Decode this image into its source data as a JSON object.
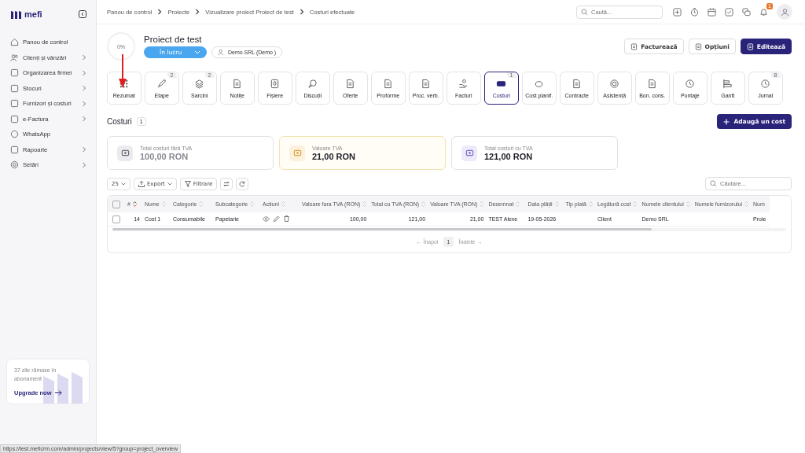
{
  "sidebar": {
    "logo": "mefi",
    "items": [
      {
        "label": "Panou de control",
        "expandable": false
      },
      {
        "label": "Clienți și vânzări",
        "expandable": true
      },
      {
        "label": "Organizarea firmei",
        "expandable": true
      },
      {
        "label": "Stocuri",
        "expandable": true
      },
      {
        "label": "Furnizori și costuri",
        "expandable": true
      },
      {
        "label": "e-Factura",
        "expandable": true
      },
      {
        "label": "WhatsApp",
        "expandable": false
      },
      {
        "label": "Rapoarte",
        "expandable": true
      },
      {
        "label": "Setări",
        "expandable": true
      }
    ],
    "upgrade": {
      "text": "37 zile rămase în abonament",
      "link": "Upgrade now"
    }
  },
  "breadcrumbs": [
    "Panou de control",
    "Proiecte",
    "Vizualizare proiect Proiect de test",
    "Costuri efectuate"
  ],
  "search": {
    "placeholder": "Caută..."
  },
  "notifications": {
    "badge": "1"
  },
  "project": {
    "progress": "0%",
    "title": "Proiect de test",
    "status": "În lucru",
    "client": "Demo SRL (Demo )"
  },
  "actions": [
    {
      "label": "Facturează",
      "primary": false
    },
    {
      "label": "Opțiuni",
      "primary": false
    },
    {
      "label": "Editează",
      "primary": true
    }
  ],
  "modules": [
    {
      "label": "Rezumat",
      "selected": false
    },
    {
      "label": "Etape",
      "badge": "2",
      "selected": false
    },
    {
      "label": "Sarcini",
      "badge": "2",
      "selected": false
    },
    {
      "label": "Notițe",
      "selected": false
    },
    {
      "label": "Fișiere",
      "selected": false
    },
    {
      "label": "Discuții",
      "selected": false
    },
    {
      "label": "Oferte",
      "selected": false
    },
    {
      "label": "Proforme",
      "selected": false
    },
    {
      "label": "Proc. verb.",
      "selected": false
    },
    {
      "label": "Facturi",
      "selected": false
    },
    {
      "label": "Costuri",
      "badge": "1",
      "selected": true
    },
    {
      "label": "Cost planif.",
      "selected": false
    },
    {
      "label": "Contracte",
      "selected": false
    },
    {
      "label": "Asistență",
      "selected": false
    },
    {
      "label": "Bon. cons.",
      "selected": false
    },
    {
      "label": "Pontaje",
      "selected": false
    },
    {
      "label": "Gantt",
      "selected": false
    },
    {
      "label": "Jurnal",
      "badge": "8",
      "selected": false
    }
  ],
  "section": {
    "title": "Costuri",
    "count": "1",
    "add_button": "Adaugă un cost"
  },
  "stats": [
    {
      "label": "Total costuri fără TVA",
      "value": "100,00 RON",
      "color": "#6b6b78",
      "highlighted": false,
      "muted": true
    },
    {
      "label": "Valoare TVA",
      "value": "21,00 RON",
      "color": "#e0a23a",
      "highlighted": true,
      "muted": false
    },
    {
      "label": "Total costuri cu TVA",
      "value": "121,00 RON",
      "color": "#7a6bd0",
      "highlighted": false,
      "muted": false
    }
  ],
  "toolbar": {
    "page_size": "25",
    "export": "Export",
    "filter": "Filtrare",
    "search_placeholder": "Căutare..."
  },
  "table": {
    "all_checked": false,
    "columns": [
      {
        "label": "#",
        "sorted": true
      },
      {
        "label": "Nume",
        "sorted": false
      },
      {
        "label": "Categorie",
        "sorted": false
      },
      {
        "label": "Subcategorie",
        "sorted": false
      },
      {
        "label": "Acțiuni",
        "sorted": false,
        "kind": "actions"
      },
      {
        "label": "Valoare fara TVA (RON)",
        "sorted": false,
        "kind": "number"
      },
      {
        "label": "Total cu TVA (RON)",
        "sorted": false,
        "kind": "number"
      },
      {
        "label": "Valoare TVA (RON)",
        "sorted": false,
        "kind": "number"
      },
      {
        "label": "Desemnat",
        "sorted": false
      },
      {
        "label": "Data plății",
        "sorted": false
      },
      {
        "label": "Tip plată",
        "sorted": false
      },
      {
        "label": "Legătură cost",
        "sorted": false
      },
      {
        "label": "Numele clientului",
        "sorted": false
      },
      {
        "label": "Numele furnizorului",
        "sorted": false
      },
      {
        "label": "Num"
      }
    ],
    "rows": [
      {
        "checked": false,
        "cells": [
          "14",
          "Cost 1",
          "Consumabile",
          "Papetarie",
          null,
          "100,00",
          "121,00",
          "21,00",
          "TEST Alexe",
          "19-05-2026",
          null,
          "Client",
          "Demo SRL",
          null,
          "Proie"
        ]
      }
    ]
  },
  "pagination": {
    "prev": "← Înapoi",
    "page": "1",
    "next": "Înainte →"
  },
  "status_url": "https://test.meficrm.com/admin/projects/view/5?group=project_overview"
}
